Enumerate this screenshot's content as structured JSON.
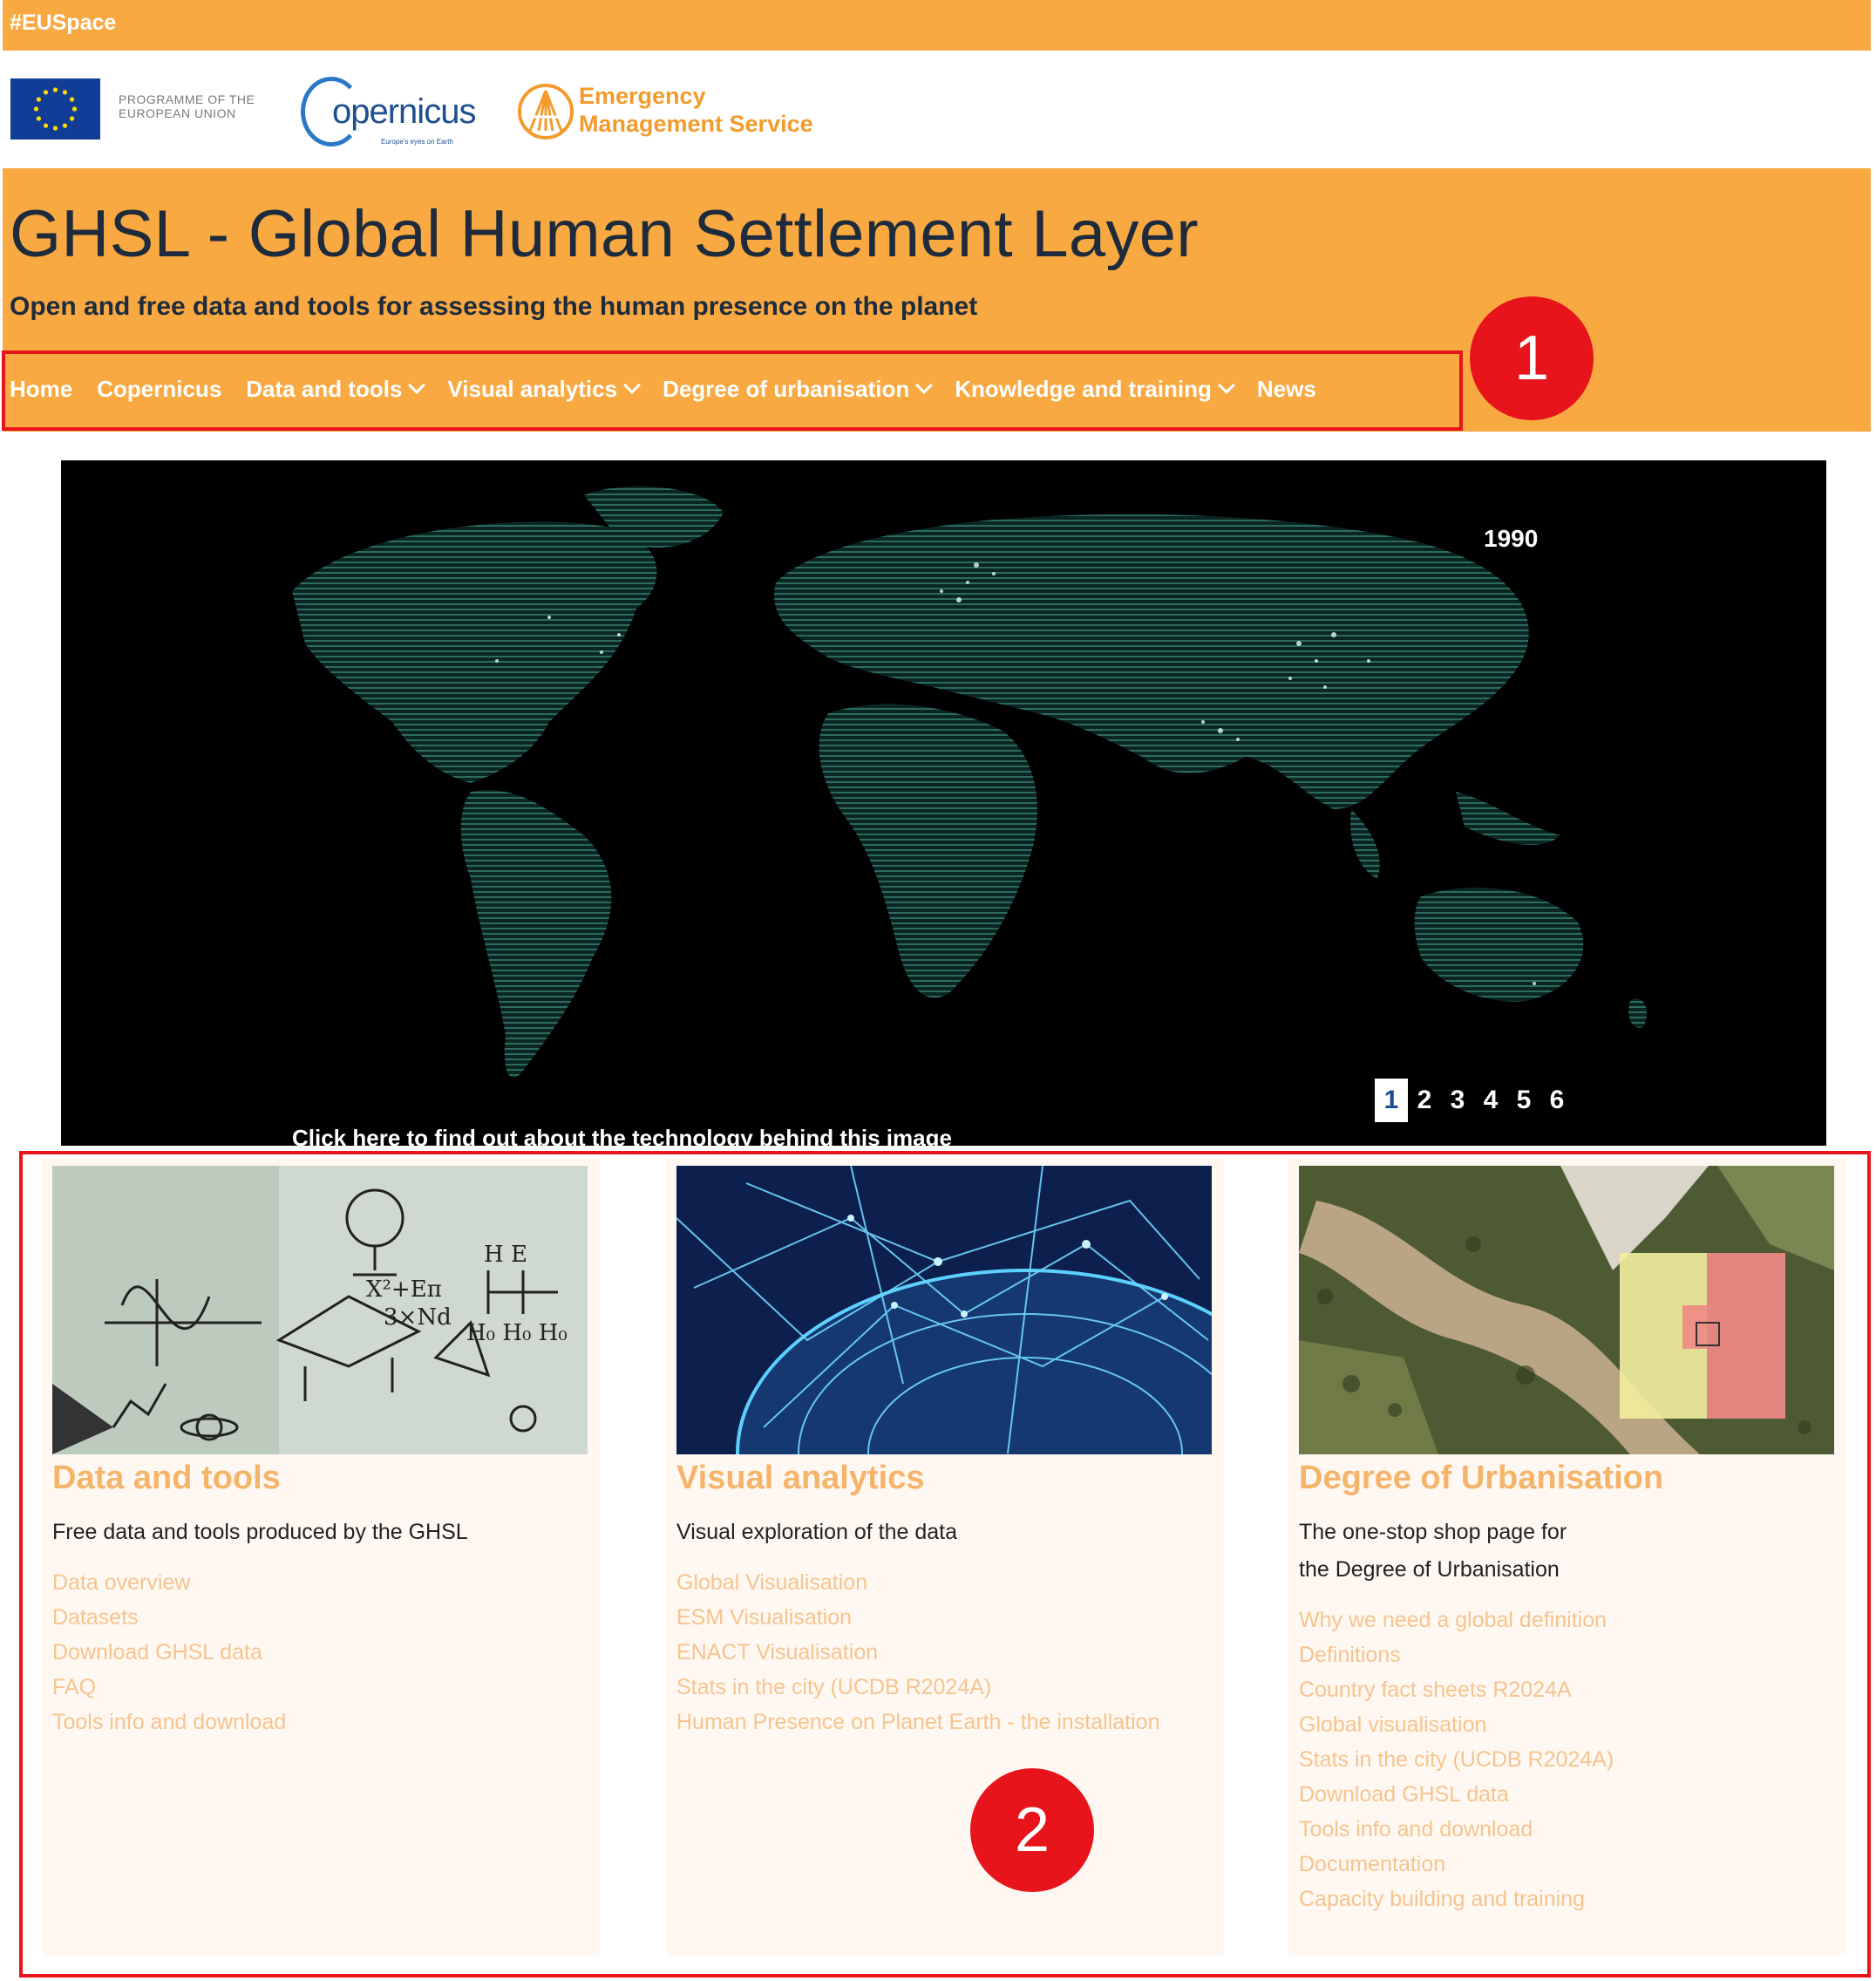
{
  "topbar": {
    "hashtag": "#EUSpace"
  },
  "logos": {
    "eu_text_line1": "PROGRAMME OF THE",
    "eu_text_line2": "EUROPEAN UNION",
    "copernicus_word": "opernicus",
    "copernicus_tag": "Europe's eyes on Earth",
    "ems_line1": "Emergency",
    "ems_line2": "Management Service"
  },
  "header": {
    "title": "GHSL - Global Human Settlement Layer",
    "subtitle": "Open and free data and tools for assessing the human presence on the planet"
  },
  "nav": {
    "items": [
      {
        "label": "Home"
      },
      {
        "label": "Copernicus"
      },
      {
        "label": "Data and tools"
      },
      {
        "label": "Visual analytics"
      },
      {
        "label": "Degree of urbanisation"
      },
      {
        "label": "Knowledge and training"
      },
      {
        "label": "News"
      }
    ]
  },
  "hero": {
    "year": "1990",
    "pages": [
      "1",
      "2",
      "3",
      "4",
      "5",
      "6"
    ],
    "active_page": "1",
    "caption": "Click here to find out about the technology behind this image"
  },
  "cards": [
    {
      "title": "Data and tools",
      "desc_lines": [
        "Free data and tools produced by the GHSL"
      ],
      "links": [
        "Data overview",
        "Datasets",
        "Download GHSL data",
        "FAQ",
        "Tools info and download"
      ]
    },
    {
      "title": "Visual analytics",
      "desc_lines": [
        "Visual exploration of the data"
      ],
      "links": [
        "Global Visualisation",
        "ESM Visualisation",
        "ENACT Visualisation",
        "Stats in the city (UCDB R2024A)",
        "Human Presence on Planet Earth - the installation"
      ]
    },
    {
      "title": "Degree of Urbanisation",
      "desc_lines": [
        "The one-stop shop page for",
        "the Degree of Urbanisation"
      ],
      "links": [
        "Why we need a global definition",
        "Definitions",
        "Country fact sheets R2024A",
        "Global visualisation",
        "Stats in the city (UCDB R2024A)",
        "Download GHSL data",
        "Tools info and download",
        "Documentation",
        "Capacity building and training"
      ]
    }
  ],
  "annotations": {
    "marker1": "1",
    "marker2": "2"
  },
  "colors": {
    "brand_orange": "#f9a942",
    "title_navy": "#1e2b3c",
    "link_peach": "#f6c48e",
    "annotation_red": "#e8141b"
  }
}
